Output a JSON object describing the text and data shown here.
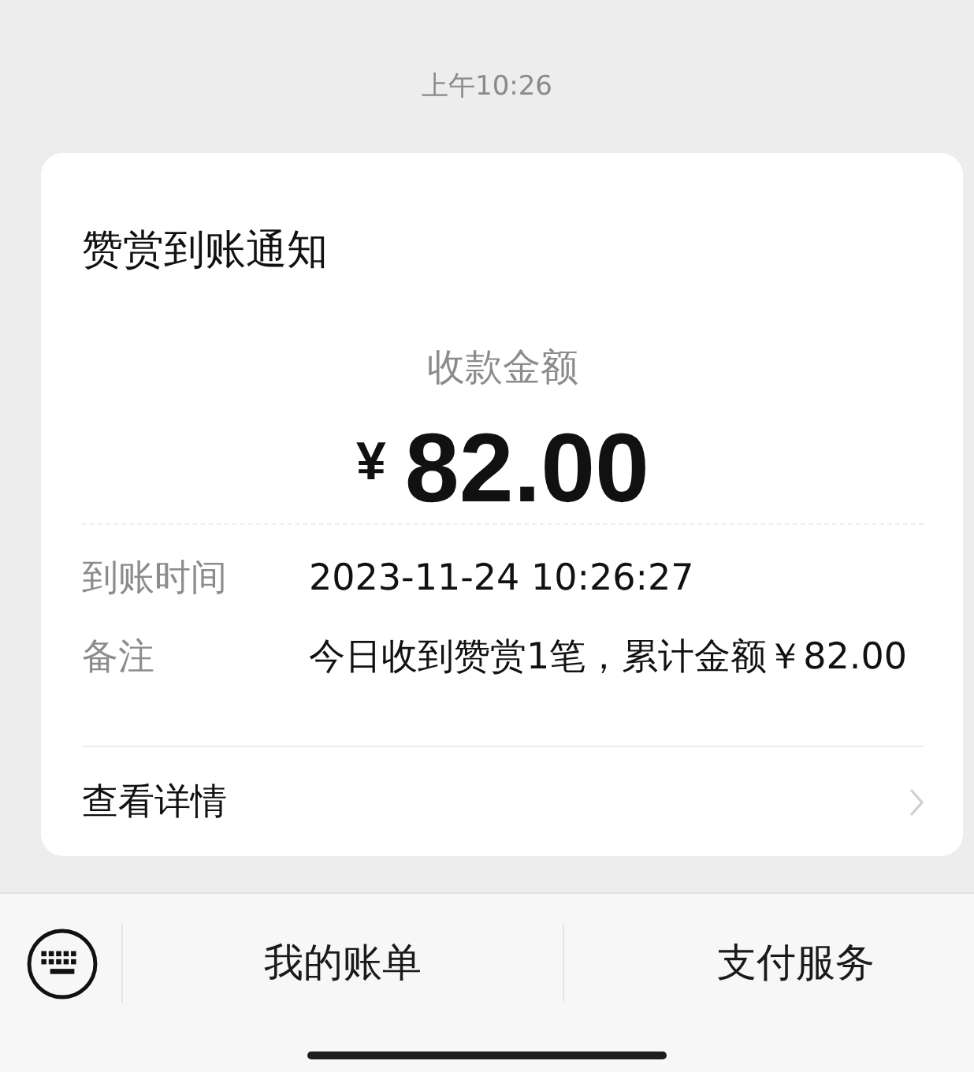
{
  "timestamp": "上午10:26",
  "card": {
    "title": "赞赏到账通知",
    "amount_label": "收款金额",
    "currency": "¥",
    "amount": "82.00",
    "details": [
      {
        "label": "到账时间",
        "value": "2023-11-24 10:26:27"
      },
      {
        "label": "备注",
        "value": "今日收到赞赏1笔，累计金额￥82.00"
      }
    ],
    "link": "查看详情"
  },
  "bottom_bar": {
    "menus": [
      "我的账单",
      "支付服务"
    ]
  }
}
